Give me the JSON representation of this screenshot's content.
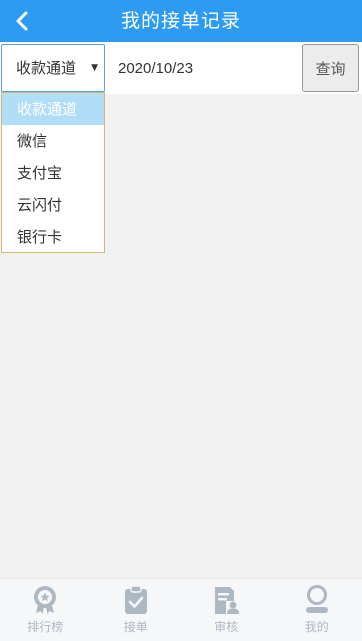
{
  "header": {
    "title": "我的接单记录",
    "back_icon": "chevron-left-icon"
  },
  "filter": {
    "select_value": "收款通道",
    "date_value": "2020/10/23",
    "query_label": "查询"
  },
  "dropdown": {
    "options": [
      {
        "label": "收款通道",
        "selected": true
      },
      {
        "label": "微信",
        "selected": false
      },
      {
        "label": "支付宝",
        "selected": false
      },
      {
        "label": "云闪付",
        "selected": false
      },
      {
        "label": "银行卡",
        "selected": false
      }
    ]
  },
  "tabbar": {
    "items": [
      {
        "label": "排行榜",
        "icon": "medal-icon"
      },
      {
        "label": "接单",
        "icon": "clipboard-check-icon"
      },
      {
        "label": "审核",
        "icon": "document-user-icon"
      },
      {
        "label": "我的",
        "icon": "user-icon"
      }
    ]
  },
  "colors": {
    "header_bg": "#2e9bf3",
    "selected_option_bg": "#b1def7",
    "tab_icon": "#aeb8c2"
  }
}
